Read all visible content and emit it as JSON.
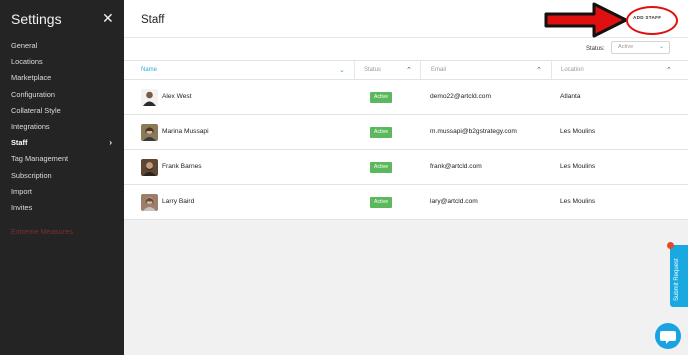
{
  "sidebar": {
    "title": "Settings",
    "close_glyph": "✕",
    "items": [
      {
        "label": "General"
      },
      {
        "label": "Locations"
      },
      {
        "label": "Marketplace"
      },
      {
        "label": "Configuration"
      },
      {
        "label": "Collateral Style"
      },
      {
        "label": "Integrations"
      },
      {
        "label": "Staff",
        "active": true
      },
      {
        "label": "Tag Management"
      },
      {
        "label": "Subscription"
      },
      {
        "label": "Import"
      },
      {
        "label": "Invites"
      }
    ],
    "extreme_label": "Extreme Measures"
  },
  "header": {
    "title": "Staff",
    "add_staff_label": "ADD STAFF"
  },
  "filter": {
    "status_label": "Status:",
    "status_value": "Active"
  },
  "table": {
    "columns": [
      "Name",
      "Status",
      "Email",
      "Location"
    ],
    "rows": [
      {
        "name": "Alex West",
        "status": "Active",
        "email": "demo22@artcld.com",
        "location": "Atlanta"
      },
      {
        "name": "Marina Mussapi",
        "status": "Active",
        "email": "m.mussapi@b2gstrategy.com",
        "location": "Les Moulins"
      },
      {
        "name": "Frank Barnes",
        "status": "Active",
        "email": "frank@artcld.com",
        "location": "Les Moulins"
      },
      {
        "name": "Larry Baird",
        "status": "Active",
        "email": "lary@artcld.com",
        "location": "Les Moulins"
      }
    ]
  },
  "widgets": {
    "submit_request_label": "Submit Request"
  },
  "colors": {
    "sidebar_bg": "#242424",
    "accent": "#2fa8e0",
    "active_badge": "#5cb85c",
    "annotation_red": "#e01010"
  }
}
